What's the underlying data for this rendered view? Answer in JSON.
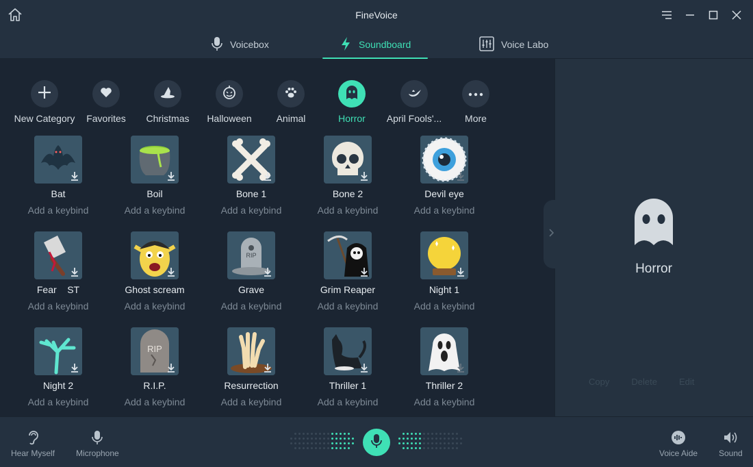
{
  "app": {
    "title": "FineVoice"
  },
  "tabs": [
    {
      "label": "Voicebox",
      "icon": "microphone-icon"
    },
    {
      "label": "Soundboard",
      "icon": "lightning-icon",
      "active": true
    },
    {
      "label": "Voice Labo",
      "icon": "sliders-icon"
    }
  ],
  "categories": [
    {
      "label": "New Category",
      "icon": "plus-icon"
    },
    {
      "label": "Favorites",
      "icon": "heart-icon"
    },
    {
      "label": "Christmas",
      "icon": "witch-hat-icon"
    },
    {
      "label": "Halloween",
      "icon": "pumpkin-icon"
    },
    {
      "label": "Animal",
      "icon": "paw-icon"
    },
    {
      "label": "Horror",
      "icon": "ghost-icon",
      "active": true
    },
    {
      "label": "April Fools'...",
      "icon": "genie-lamp-icon"
    },
    {
      "label": "More",
      "icon": "more-dots-icon"
    }
  ],
  "keybind_text": "Add a keybind",
  "sounds": [
    {
      "name": "Bat",
      "keybind": "Add a keybind"
    },
    {
      "name": "Boil",
      "keybind": "Add a keybind"
    },
    {
      "name": "Bone 1",
      "keybind": "Add a keybind"
    },
    {
      "name": "Bone 2",
      "keybind": "Add a keybind"
    },
    {
      "name": "Devil eye",
      "keybind": "Add a keybind"
    },
    {
      "name": "Fear    ST",
      "keybind": "Add a keybind"
    },
    {
      "name": "Ghost scream",
      "keybind": "Add a keybind"
    },
    {
      "name": "Grave",
      "keybind": "Add a keybind"
    },
    {
      "name": "Grim Reaper",
      "keybind": "Add a keybind"
    },
    {
      "name": "Night 1",
      "keybind": "Add a keybind"
    },
    {
      "name": "Night 2",
      "keybind": "Add a keybind"
    },
    {
      "name": "R.I.P.",
      "keybind": "Add a keybind"
    },
    {
      "name": "Resurrection",
      "keybind": "Add a keybind"
    },
    {
      "name": "Thriller 1",
      "keybind": "Add a keybind"
    },
    {
      "name": "Thriller 2",
      "keybind": "Add a keybind"
    }
  ],
  "thumb_text": {
    "grave": "RIP",
    "rip": "RIP"
  },
  "side_panel": {
    "title": "Horror",
    "actions": {
      "copy": "Copy",
      "delete": "Delete",
      "edit": "Edit"
    }
  },
  "bottom": {
    "hear_myself": "Hear Myself",
    "microphone": "Microphone",
    "voice_aide": "Voice Aide",
    "sound": "Sound"
  },
  "colors": {
    "accent": "#3fe0b5",
    "background": "#1b2532",
    "panel": "#243140"
  }
}
